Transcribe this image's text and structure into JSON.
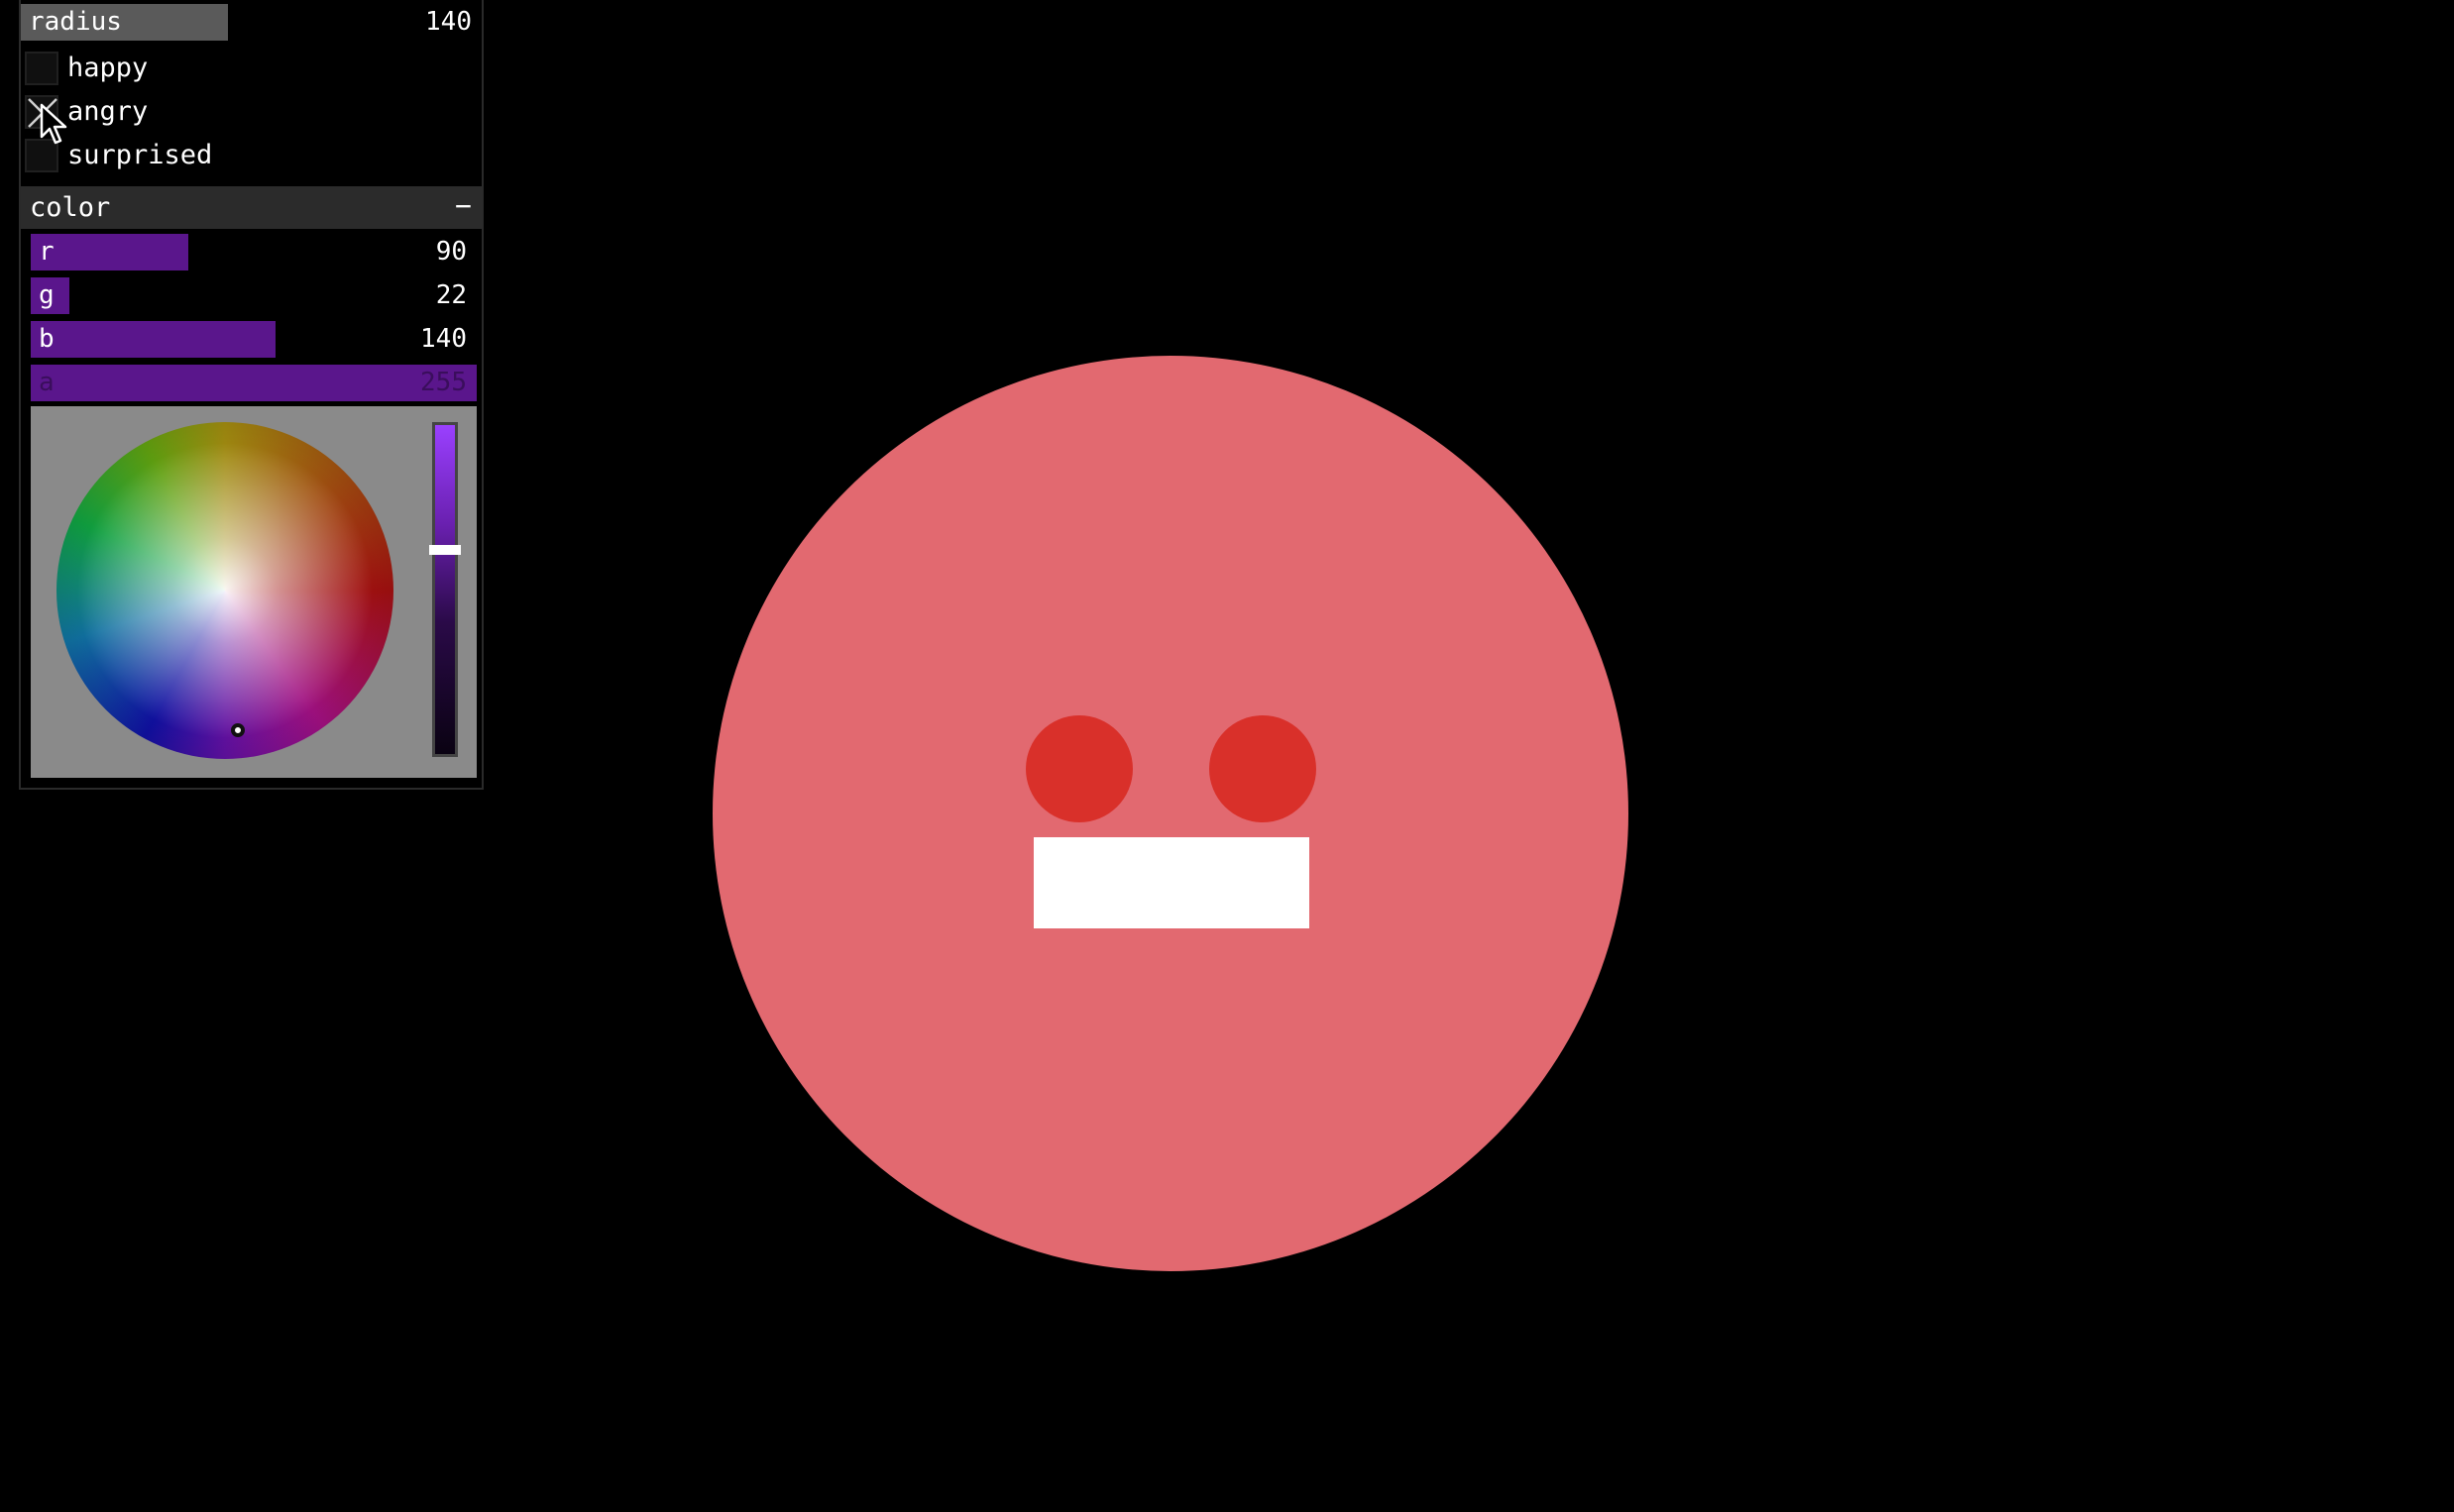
{
  "gui": {
    "radius": {
      "label": "radius",
      "value": "140",
      "fraction": 0.45,
      "fill_color": "#5a5a5a"
    },
    "toggles": [
      {
        "label": "happy",
        "checked": false
      },
      {
        "label": "angry",
        "checked": true
      },
      {
        "label": "surprised",
        "checked": false
      }
    ],
    "color_group": {
      "title": "color",
      "collapse_symbol": "−",
      "sliders": [
        {
          "label": "r",
          "value": "90",
          "fraction": 0.353
        },
        {
          "label": "g",
          "value": "22",
          "fraction": 0.086
        },
        {
          "label": "b",
          "value": "140",
          "fraction": 0.549
        },
        {
          "label": "a",
          "value": "255",
          "fraction": 1.0
        }
      ],
      "slider_fill_color": "#5a168c",
      "brightness_level": 0.38
    }
  },
  "face": {
    "fill_color": "#e26970",
    "eye_color": "#d9302a",
    "mouth_color": "#ffffff"
  }
}
